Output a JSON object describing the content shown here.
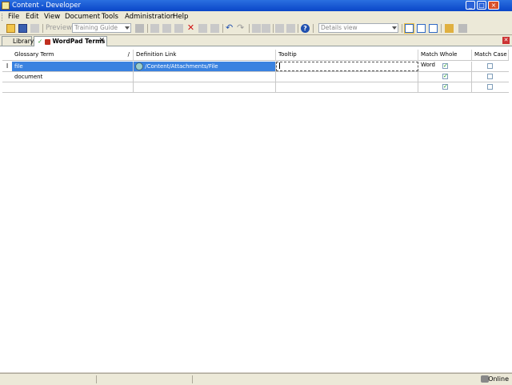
{
  "window": {
    "title": "Content - Developer"
  },
  "menu": [
    "File",
    "Edit",
    "View",
    "Document",
    "Tools",
    "Administration",
    "Help"
  ],
  "toolbar": {
    "preview_label": "Preview",
    "guide_combo": "Training Guide",
    "view_combo": "Details view"
  },
  "tabs": [
    {
      "label": "Library"
    },
    {
      "label": "WordPad Terms"
    }
  ],
  "grid": {
    "columns": [
      "Glossary Term",
      "Definition Link",
      "Tooltip",
      "Match Whole Word",
      "Match Case"
    ],
    "sort_indicator": "/",
    "rows": [
      {
        "term": "file",
        "link": "/Content/Attachments/File",
        "tooltip": "",
        "whole": true,
        "case": false
      },
      {
        "term": "document",
        "link": "",
        "tooltip": "",
        "whole": true,
        "case": false
      },
      {
        "term": "",
        "link": "",
        "tooltip": "",
        "whole": true,
        "case": false
      }
    ]
  },
  "status": {
    "online": "Online"
  }
}
